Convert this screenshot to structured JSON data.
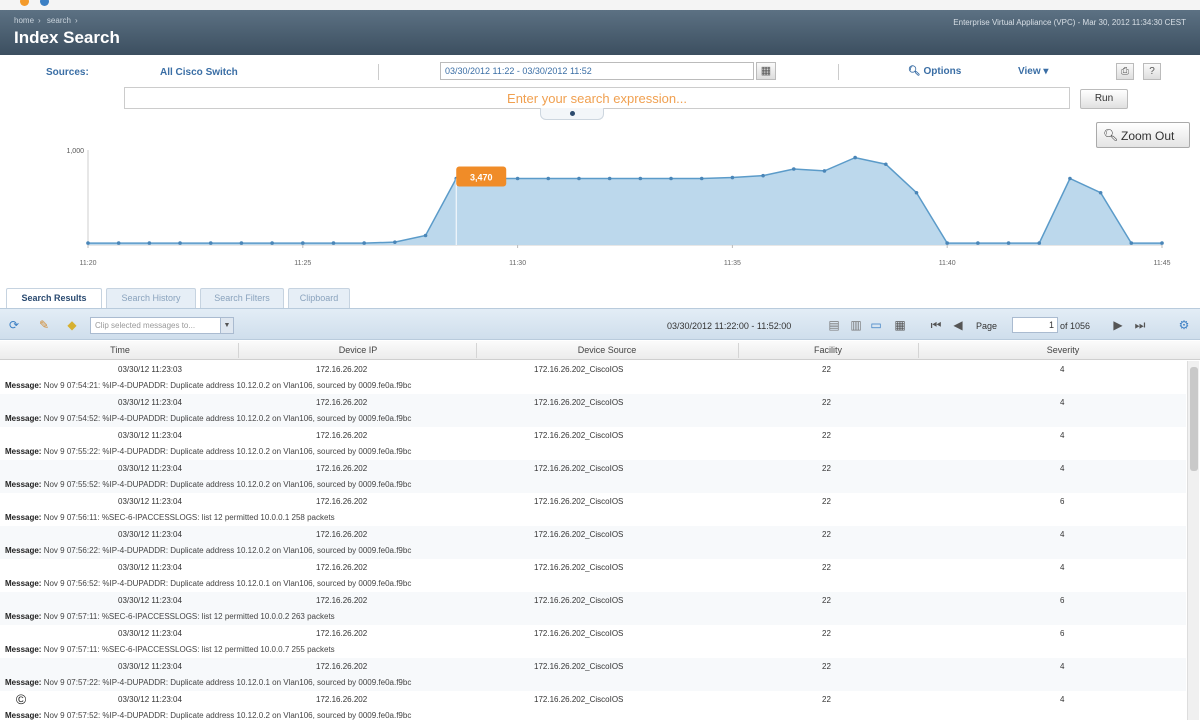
{
  "header": {
    "breadcrumb": [
      "home",
      "search"
    ],
    "title": "Index Search",
    "status": "Enterprise Virtual Appliance (VPC) - Mar 30, 2012 11:34:30 CEST"
  },
  "toolbar": {
    "sources_label": "Sources:",
    "sources_value": "All Cisco Switch",
    "date_range": "03/30/2012 11:22 - 03/30/2012 11:52",
    "options_label": "Options",
    "view_label": "View ▾"
  },
  "search": {
    "placeholder": "Enter your search expression...",
    "run_label": "Run"
  },
  "zoom_out_label": "Zoom Out",
  "chart_data": {
    "type": "area",
    "ymax_label": "1,000",
    "highlight_label": "3,470",
    "x_ticks": [
      "11:20",
      "11:25",
      "11:30",
      "11:35",
      "11:40",
      "11:45"
    ],
    "values": [
      2,
      2,
      2,
      2,
      2,
      2,
      2,
      2,
      2,
      2,
      3,
      10,
      70,
      70,
      70,
      70,
      70,
      70,
      70,
      70,
      70,
      71,
      73,
      80,
      78,
      92,
      85,
      55,
      2,
      2,
      2,
      2,
      70,
      55,
      2,
      2
    ],
    "highlight_index": 12,
    "fill_color": "#bcd8ec",
    "line_color": "#5b9bc9"
  },
  "tabs": [
    "Search Results",
    "Search History",
    "Search Filters",
    "Clipboard"
  ],
  "results_toolbar": {
    "filter_placeholder": "Clip selected messages to...",
    "range": "03/30/2012 11:22:00 - 11:52:00",
    "page_label": "Page",
    "page_value": "1",
    "page_of": "of 1056"
  },
  "table": {
    "columns": [
      "Time",
      "Device IP",
      "Device Source",
      "Facility",
      "Severity"
    ],
    "message_label": "Message:",
    "rows": [
      {
        "time": "03/30/12 11:23:03",
        "ip": "172.16.26.202",
        "source": "172.16.26.202_CiscoIOS",
        "facility": "22",
        "severity": "4",
        "message": "Nov 9 07:54:21: %IP-4-DUPADDR: Duplicate address 10.12.0.2 on Vlan106, sourced by 0009.fe0a.f9bc"
      },
      {
        "time": "03/30/12 11:23:04",
        "ip": "172.16.26.202",
        "source": "172.16.26.202_CiscoIOS",
        "facility": "22",
        "severity": "4",
        "message": "Nov 9 07:54:52: %IP-4-DUPADDR: Duplicate address 10.12.0.2 on Vlan106, sourced by 0009.fe0a.f9bc"
      },
      {
        "time": "03/30/12 11:23:04",
        "ip": "172.16.26.202",
        "source": "172.16.26.202_CiscoIOS",
        "facility": "22",
        "severity": "4",
        "message": "Nov 9 07:55:22: %IP-4-DUPADDR: Duplicate address 10.12.0.2 on Vlan106, sourced by 0009.fe0a.f9bc"
      },
      {
        "time": "03/30/12 11:23:04",
        "ip": "172.16.26.202",
        "source": "172.16.26.202_CiscoIOS",
        "facility": "22",
        "severity": "4",
        "message": "Nov 9 07:55:52: %IP-4-DUPADDR: Duplicate address 10.12.0.2 on Vlan106, sourced by 0009.fe0a.f9bc"
      },
      {
        "time": "03/30/12 11:23:04",
        "ip": "172.16.26.202",
        "source": "172.16.26.202_CiscoIOS",
        "facility": "22",
        "severity": "6",
        "message": "Nov 9 07:56:11: %SEC-6-IPACCESSLOGS: list 12 permitted 10.0.0.1 258 packets"
      },
      {
        "time": "03/30/12 11:23:04",
        "ip": "172.16.26.202",
        "source": "172.16.26.202_CiscoIOS",
        "facility": "22",
        "severity": "4",
        "message": "Nov 9 07:56:22: %IP-4-DUPADDR: Duplicate address 10.12.0.2 on Vlan106, sourced by 0009.fe0a.f9bc"
      },
      {
        "time": "03/30/12 11:23:04",
        "ip": "172.16.26.202",
        "source": "172.16.26.202_CiscoIOS",
        "facility": "22",
        "severity": "4",
        "message": "Nov 9 07:56:52: %IP-4-DUPADDR: Duplicate address 10.12.0.1 on Vlan106, sourced by 0009.fe0a.f9bc"
      },
      {
        "time": "03/30/12 11:23:04",
        "ip": "172.16.26.202",
        "source": "172.16.26.202_CiscoIOS",
        "facility": "22",
        "severity": "6",
        "message": "Nov 9 07:57:11: %SEC-6-IPACCESSLOGS: list 12 permitted 10.0.0.2 263 packets"
      },
      {
        "time": "03/30/12 11:23:04",
        "ip": "172.16.26.202",
        "source": "172.16.26.202_CiscoIOS",
        "facility": "22",
        "severity": "6",
        "message": "Nov 9 07:57:11: %SEC-6-IPACCESSLOGS: list 12 permitted 10.0.0.7 255 packets"
      },
      {
        "time": "03/30/12 11:23:04",
        "ip": "172.16.26.202",
        "source": "172.16.26.202_CiscoIOS",
        "facility": "22",
        "severity": "4",
        "message": "Nov 9 07:57:22: %IP-4-DUPADDR: Duplicate address 10.12.0.1 on Vlan106, sourced by 0009.fe0a.f9bc"
      },
      {
        "time": "03/30/12 11:23:04",
        "ip": "172.16.26.202",
        "source": "172.16.26.202_CiscoIOS",
        "facility": "22",
        "severity": "4",
        "message": "Nov 9 07:57:52: %IP-4-DUPADDR: Duplicate address 10.12.0.2 on Vlan106, sourced by 0009.fe0a.f9bc"
      }
    ]
  }
}
